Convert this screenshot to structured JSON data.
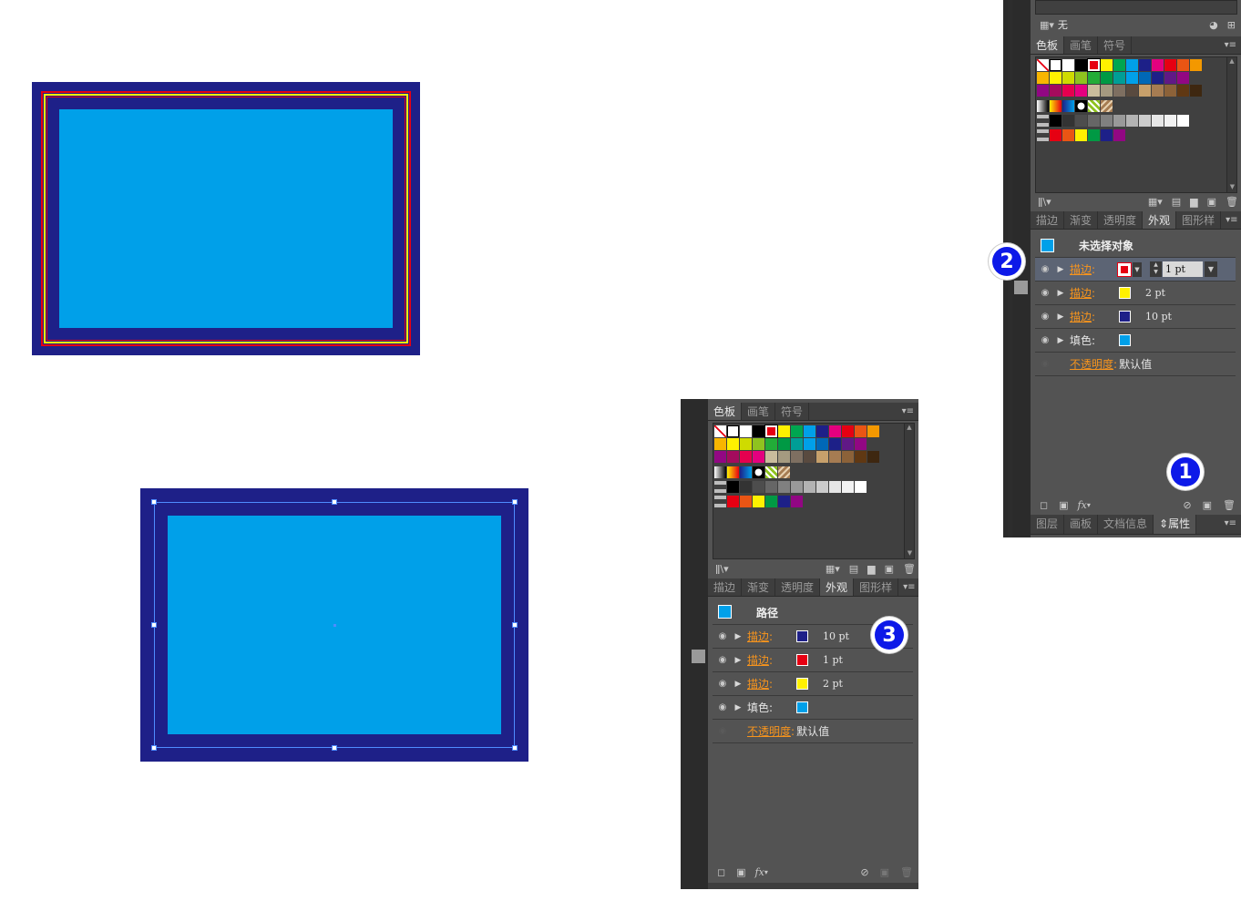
{
  "colors": {
    "navy": "#1e2088",
    "cyan": "#00a0e9",
    "red": "#e60012",
    "yellow": "#fff100",
    "badge": "#0d19e8",
    "link_orange": "#f7941d"
  },
  "top_right_panel": {
    "brush_row": {
      "brush_icon": "brush-library-icon",
      "none_label": "无"
    },
    "tabs": [
      "色板",
      "画笔",
      "符号"
    ],
    "appearance_tabs": [
      "描边",
      "渐变",
      "透明度",
      "外观",
      "图形样"
    ],
    "header_title": "未选择对象",
    "rows": [
      {
        "label": "描边",
        "color": "#e60012",
        "value": "1 pt",
        "highlighted": true
      },
      {
        "label": "描边",
        "color": "#fff100",
        "value": "2 pt"
      },
      {
        "label": "描边",
        "color": "#1e2088",
        "value": "10 pt"
      },
      {
        "label": "填色",
        "color": "#00a0e9",
        "value": ""
      }
    ],
    "opacity_label": "不透明度",
    "opacity_value": "默认值",
    "bottom_tabs": [
      "图层",
      "画板",
      "文档信息",
      "属性"
    ]
  },
  "bottom_panel": {
    "tabs": [
      "色板",
      "画笔",
      "符号"
    ],
    "appearance_tabs": [
      "描边",
      "渐变",
      "透明度",
      "外观",
      "图形样"
    ],
    "header_title": "路径",
    "rows": [
      {
        "label": "描边",
        "color": "#1e2088",
        "value": "10 pt"
      },
      {
        "label": "描边",
        "color": "#e60012",
        "value": "1 pt"
      },
      {
        "label": "描边",
        "color": "#fff100",
        "value": "2 pt"
      },
      {
        "label": "填色",
        "color": "#00a0e9",
        "value": ""
      }
    ],
    "opacity_label": "不透明度",
    "opacity_value": "默认值"
  },
  "badges": {
    "one": "1",
    "two": "2",
    "three": "3"
  },
  "fx_label": "fx"
}
